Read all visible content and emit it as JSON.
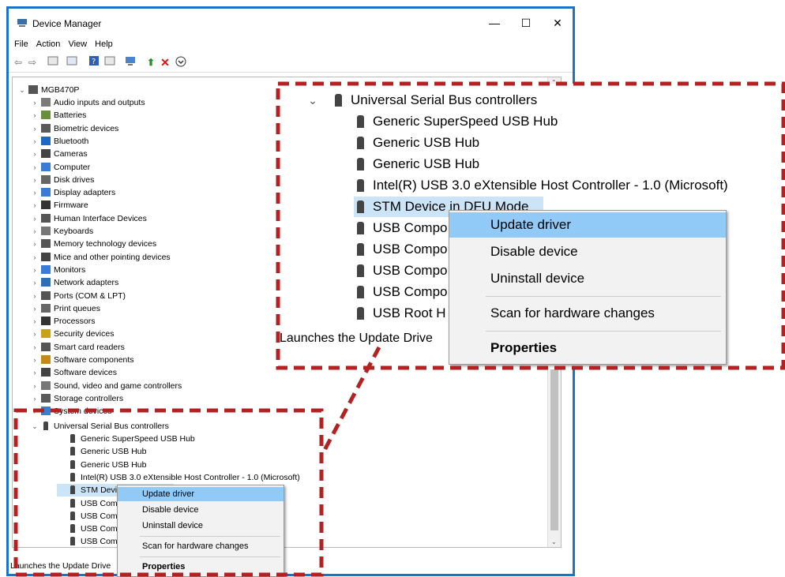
{
  "window": {
    "title": "Device Manager",
    "minimize": "—",
    "maximize": "☐",
    "close": "✕"
  },
  "menu": [
    "File",
    "Action",
    "View",
    "Help"
  ],
  "tree": {
    "root": "MGB470P",
    "categories": [
      "Audio inputs and outputs",
      "Batteries",
      "Biometric devices",
      "Bluetooth",
      "Cameras",
      "Computer",
      "Disk drives",
      "Display adapters",
      "Firmware",
      "Human Interface Devices",
      "Keyboards",
      "Memory technology devices",
      "Mice and other pointing devices",
      "Monitors",
      "Network adapters",
      "Ports (COM & LPT)",
      "Print queues",
      "Processors",
      "Security devices",
      "Smart card readers",
      "Software components",
      "Software devices",
      "Sound, video and game controllers",
      "Storage controllers",
      "System devices"
    ],
    "usb_category": "Universal Serial Bus controllers",
    "usb_children": [
      "Generic SuperSpeed USB Hub",
      "Generic USB Hub",
      "Generic USB Hub",
      "Intel(R) USB 3.0 eXtensible Host Controller - 1.0 (Microsoft)",
      "STM Device in DFU Mode",
      "USB Compo",
      "USB Compo",
      "USB Compo",
      "USB Compo",
      "USB Root H"
    ]
  },
  "context_menu": {
    "update": "Update driver",
    "disable": "Disable device",
    "uninstall": "Uninstall device",
    "scan": "Scan for hardware changes",
    "properties": "Properties"
  },
  "status": "Launches the Update Drive",
  "colors": {
    "accent": "#1a73c7",
    "highlight": "#91c9f7",
    "selection": "#cce4f7",
    "callout": "#b22222"
  },
  "icons": {
    "toolbar": [
      "back-icon",
      "forward-icon",
      "properties-icon",
      "show-hidden-icon",
      "help-icon",
      "view-icon",
      "monitor-icon",
      "update-driver-icon",
      "uninstall-icon",
      "enable-icon"
    ]
  }
}
